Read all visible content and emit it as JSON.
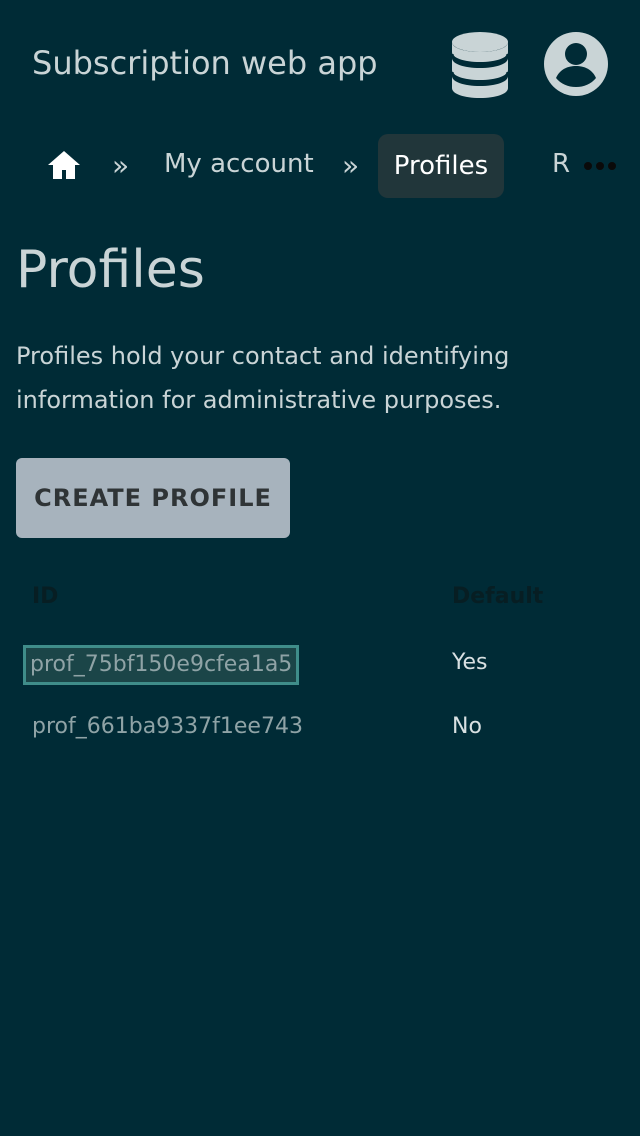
{
  "header": {
    "app_title": "Subscription web app",
    "db_icon": "database-icon",
    "account_icon": "account-circle-icon"
  },
  "breadcrumb": {
    "home_icon": "home-icon",
    "separator": "»",
    "items": [
      "My account",
      "Profiles",
      "R"
    ],
    "active_index": 1,
    "more_icon": "more-horizontal-icon"
  },
  "main": {
    "title": "Profiles",
    "description": "Profiles hold your contact and identifying information for administrative purposes.",
    "create_label": "CREATE PROFILE"
  },
  "table": {
    "columns": [
      "ID",
      "Default"
    ],
    "rows": [
      {
        "id": "prof_75bf150e9cfea1a5",
        "default": "Yes"
      },
      {
        "id": "prof_661ba9337f1ee743",
        "default": "No"
      }
    ]
  },
  "colors": {
    "background": "#002b36",
    "text": "#c9d4d6",
    "active_crumb_bg": "#21363a",
    "button_bg": "#a7b3bd",
    "selection_outline": "#3f8d8a"
  }
}
